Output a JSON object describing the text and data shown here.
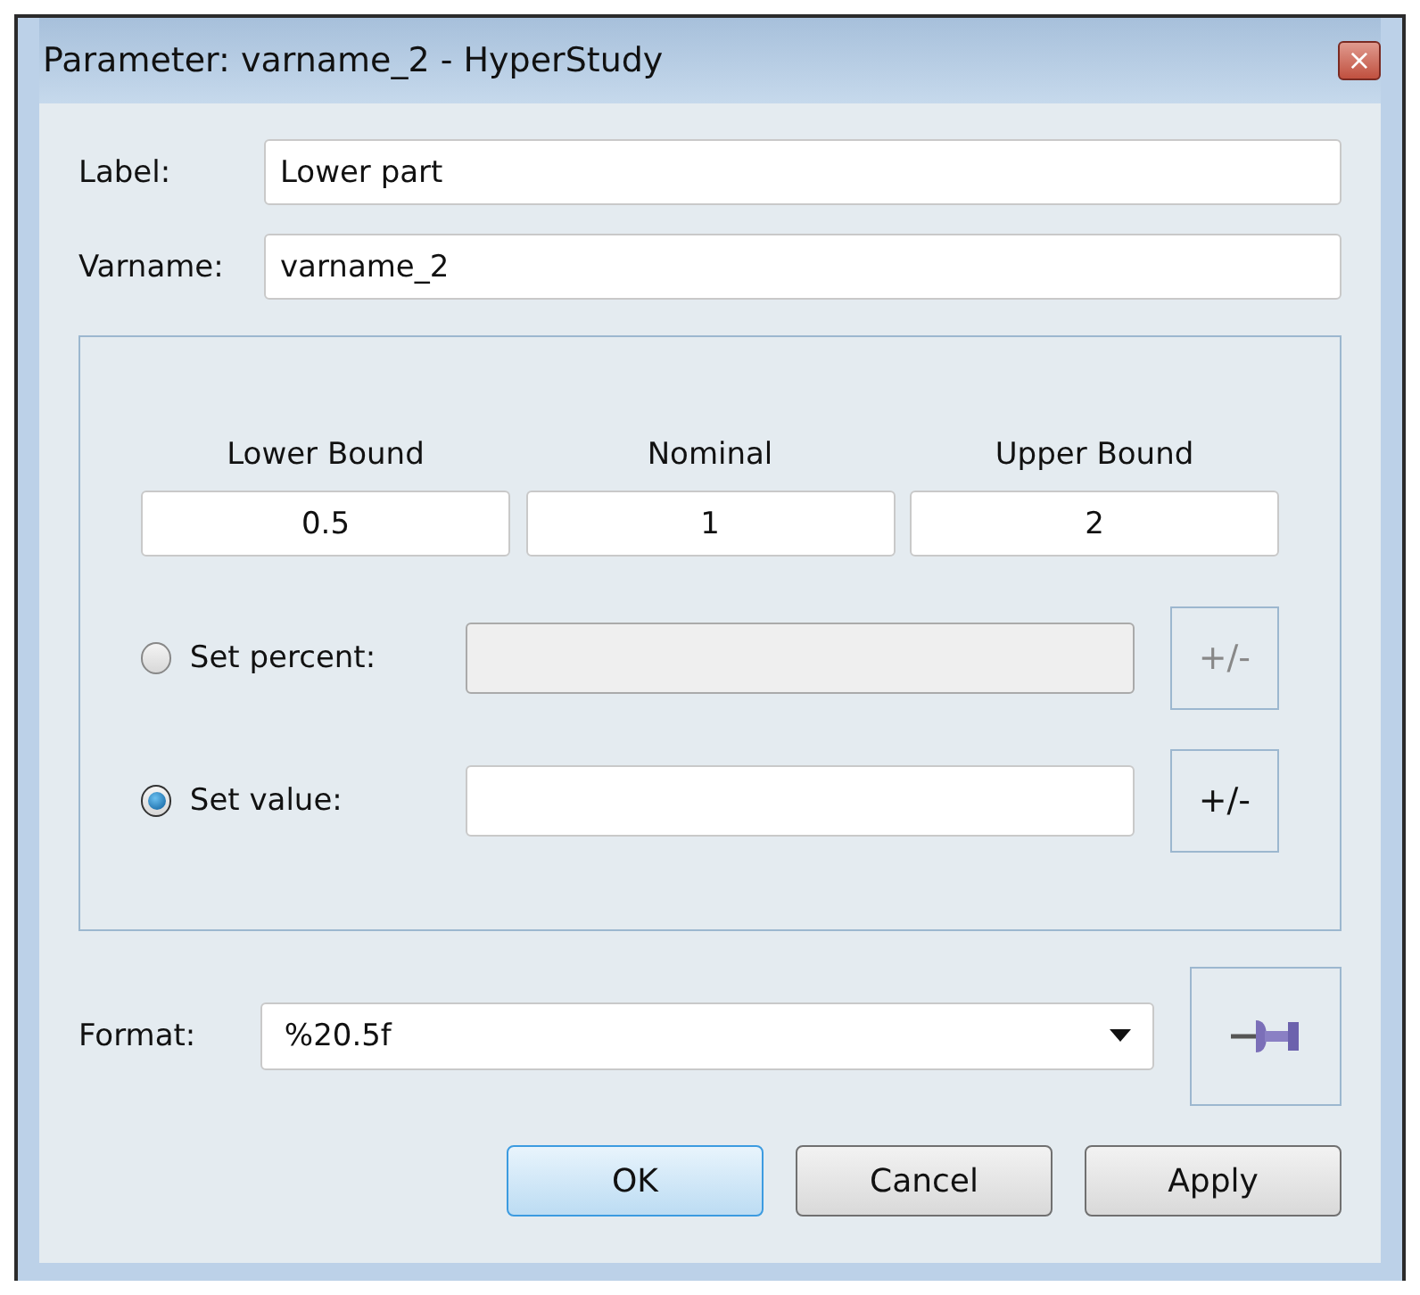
{
  "window": {
    "title": "Parameter: varname_2 - HyperStudy",
    "close": "×"
  },
  "fields": [
    {
      "label": "Label:",
      "value": "Lower part"
    },
    {
      "label": "Varname:",
      "value": "varname_2"
    }
  ],
  "bounds": [
    {
      "label": "Lower Bound",
      "value": "0.5"
    },
    {
      "label": "Nominal",
      "value": "1"
    },
    {
      "label": "Upper Bound",
      "value": "2"
    }
  ],
  "modes": [
    {
      "label": "Set percent:",
      "selected": false,
      "button": "+/-"
    },
    {
      "label": "Set value:",
      "selected": true,
      "button": "+/-"
    }
  ],
  "format": {
    "label": "Format:",
    "value": "%20.5f"
  },
  "buttons": [
    {
      "label": "OK",
      "default": true
    },
    {
      "label": "Cancel",
      "default": false
    },
    {
      "label": "Apply",
      "default": false
    }
  ]
}
